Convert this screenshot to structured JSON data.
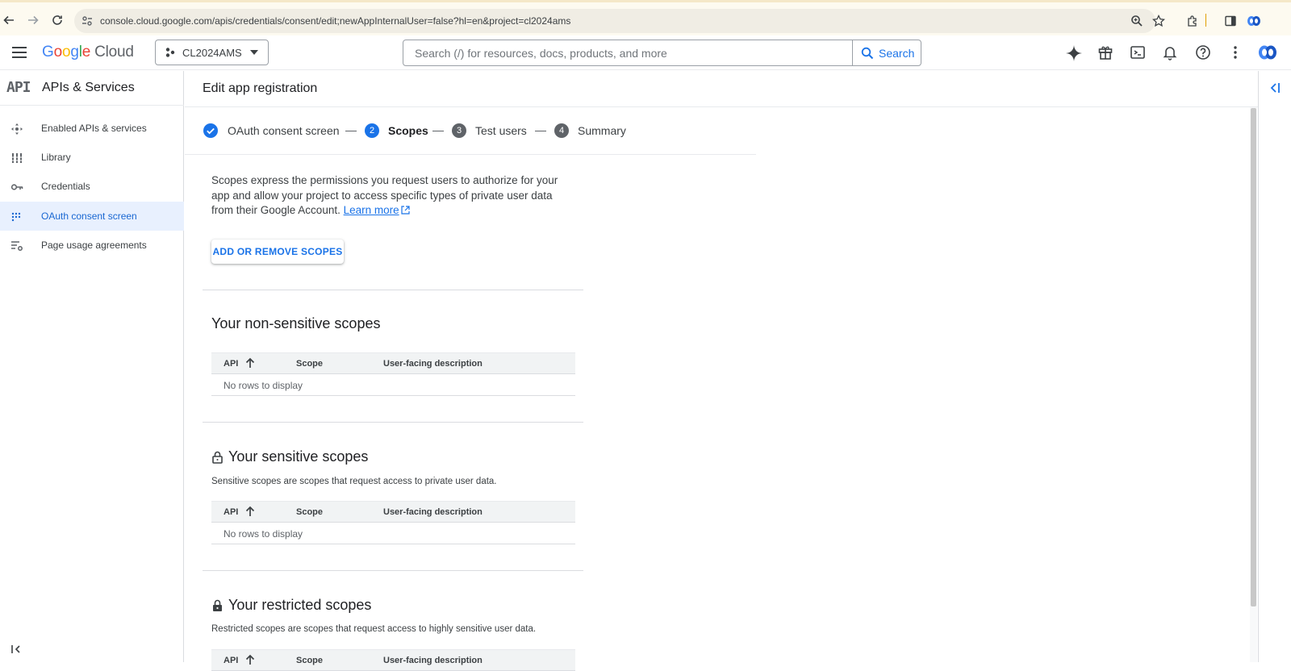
{
  "browser": {
    "url": "console.cloud.google.com/apis/credentials/consent/edit;newAppInternalUser=false?hl=en&project=cl2024ams"
  },
  "header": {
    "logo_google": [
      "G",
      "o",
      "o",
      "g",
      "l",
      "e"
    ],
    "logo_cloud": "Cloud",
    "project": "CL2024AMS",
    "search_placeholder": "Search (/) for resources, docs, products, and more",
    "search_button": "Search"
  },
  "sidebar": {
    "icon_text": "API",
    "title": "APIs & Services",
    "items": [
      {
        "label": "Enabled APIs & services",
        "icon": "enabled-apis-icon"
      },
      {
        "label": "Library",
        "icon": "library-icon"
      },
      {
        "label": "Credentials",
        "icon": "key-icon"
      },
      {
        "label": "OAuth consent screen",
        "icon": "oauth-dots-icon",
        "active": true
      },
      {
        "label": "Page usage agreements",
        "icon": "settings-list-icon"
      }
    ]
  },
  "main": {
    "title": "Edit app registration",
    "steps": [
      {
        "number": "",
        "label": "OAuth consent screen",
        "state": "done"
      },
      {
        "number": "2",
        "label": "Scopes",
        "state": "current"
      },
      {
        "number": "3",
        "label": "Test users",
        "state": "todo"
      },
      {
        "number": "4",
        "label": "Summary",
        "state": "todo"
      }
    ],
    "description": "Scopes express the permissions you request users to authorize for your app and allow your project to access specific types of private user data from their Google Account.",
    "learn_more": "Learn more",
    "add_remove_button": "ADD OR REMOVE SCOPES",
    "table_columns": [
      "API",
      "Scope",
      "User-facing description"
    ],
    "empty_text": "No rows to display",
    "sections": {
      "non_sensitive": {
        "title": "Your non-sensitive scopes"
      },
      "sensitive": {
        "title": "Your sensitive scopes",
        "subtitle": "Sensitive scopes are scopes that request access to private user data."
      },
      "restricted": {
        "title": "Your restricted scopes",
        "subtitle": "Restricted scopes are scopes that request access to highly sensitive user data."
      }
    }
  },
  "colors": {
    "accent": "#1a73e8",
    "active_bg": "#e8f0fe"
  }
}
